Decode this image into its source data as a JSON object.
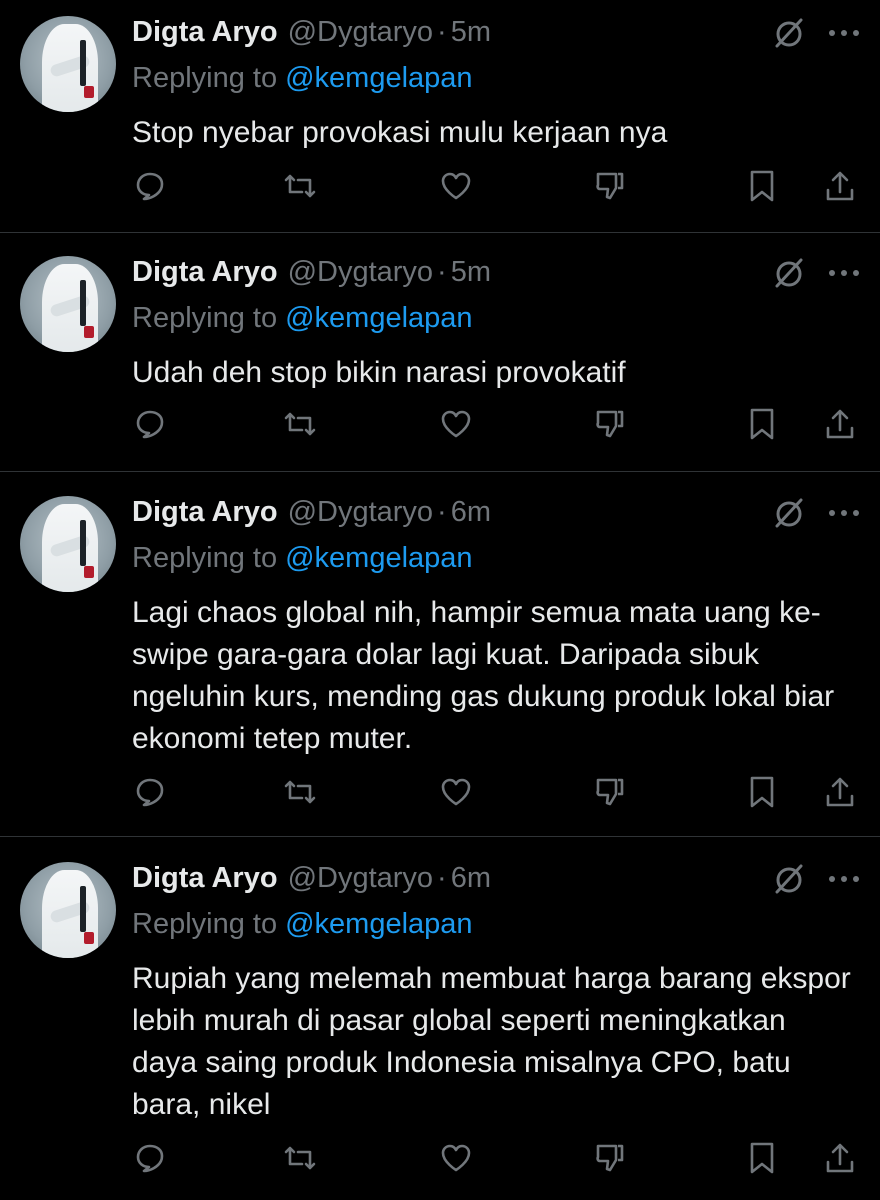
{
  "tweets": [
    {
      "name": "Digta Aryo",
      "handle": "@Dygtaryo",
      "separator": "·",
      "time": "5m",
      "replying_label": "Replying to",
      "replying_to": "@kemgelapan",
      "text": "Stop nyebar provokasi mulu kerjaan nya"
    },
    {
      "name": "Digta Aryo",
      "handle": "@Dygtaryo",
      "separator": "·",
      "time": "5m",
      "replying_label": "Replying to",
      "replying_to": "@kemgelapan",
      "text": "Udah deh stop bikin narasi provokatif"
    },
    {
      "name": "Digta Aryo",
      "handle": "@Dygtaryo",
      "separator": "·",
      "time": "6m",
      "replying_label": "Replying to",
      "replying_to": "@kemgelapan",
      "text": "Lagi chaos global nih, hampir semua mata uang ke-swipe gara-gara dolar lagi kuat. Daripada sibuk ngeluhin kurs, mending gas dukung produk lokal biar ekonomi tetep muter."
    },
    {
      "name": "Digta Aryo",
      "handle": "@Dygtaryo",
      "separator": "·",
      "time": "6m",
      "replying_label": "Replying to",
      "replying_to": "@kemgelapan",
      "text": "Rupiah yang melemah membuat harga barang ekspor lebih murah di pasar global seperti meningkatkan daya saing produk Indonesia misalnya CPO, batu bara, nikel"
    }
  ],
  "icons": {
    "header": [
      "mute-icon",
      "more-icon"
    ],
    "actions": [
      "reply-icon",
      "retweet-icon",
      "like-icon",
      "dislike-icon",
      "bookmark-icon",
      "share-icon"
    ]
  },
  "colors": {
    "background": "#000000",
    "text_primary": "#e7e9ea",
    "text_secondary": "#71767b",
    "link": "#1d9bf0",
    "divider": "#2f3336"
  }
}
